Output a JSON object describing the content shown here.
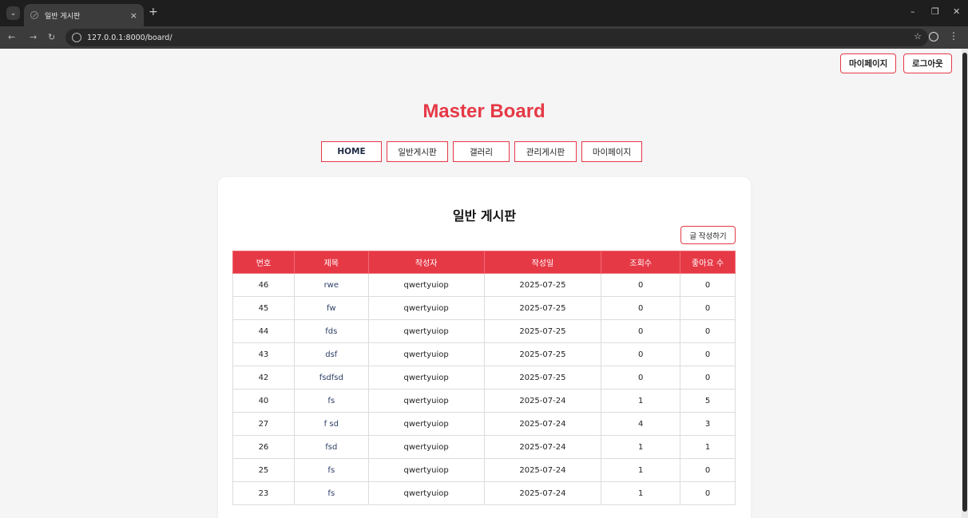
{
  "browser": {
    "tab_title": "일반 게시판",
    "tab_close": "×",
    "new_tab": "+",
    "url": "127.0.0.1:8000/board/",
    "controls": {
      "minimize": "–",
      "restore": "❐",
      "close": "✕"
    }
  },
  "header": {
    "mypage_label": "마이페이지",
    "logout_label": "로그아웃",
    "site_title": "Master Board"
  },
  "nav": {
    "items": [
      {
        "label": "HOME"
      },
      {
        "label": "일반게시판"
      },
      {
        "label": "갤러리"
      },
      {
        "label": "관리게시판"
      },
      {
        "label": "마이페이지"
      }
    ]
  },
  "board": {
    "title": "일반 게시판",
    "write_label": "글 작성하기",
    "columns": [
      "번호",
      "제목",
      "작성자",
      "작성일",
      "조회수",
      "좋아요 수"
    ],
    "rows": [
      [
        "46",
        "rwe",
        "qwertyuiop",
        "2025-07-25",
        "0",
        "0"
      ],
      [
        "45",
        "fw",
        "qwertyuiop",
        "2025-07-25",
        "0",
        "0"
      ],
      [
        "44",
        "fds",
        "qwertyuiop",
        "2025-07-25",
        "0",
        "0"
      ],
      [
        "43",
        "dsf",
        "qwertyuiop",
        "2025-07-25",
        "0",
        "0"
      ],
      [
        "42",
        "fsdfsd",
        "qwertyuiop",
        "2025-07-25",
        "0",
        "0"
      ],
      [
        "40",
        "fs",
        "qwertyuiop",
        "2025-07-24",
        "1",
        "5"
      ],
      [
        "27",
        "f sd",
        "qwertyuiop",
        "2025-07-24",
        "4",
        "3"
      ],
      [
        "26",
        "fsd",
        "qwertyuiop",
        "2025-07-24",
        "1",
        "1"
      ],
      [
        "25",
        "fs",
        "qwertyuiop",
        "2025-07-24",
        "1",
        "0"
      ],
      [
        "23",
        "fs",
        "qwertyuiop",
        "2025-07-24",
        "1",
        "0"
      ]
    ]
  },
  "colors": {
    "accent": "#e63946",
    "link": "#2c3e66"
  }
}
